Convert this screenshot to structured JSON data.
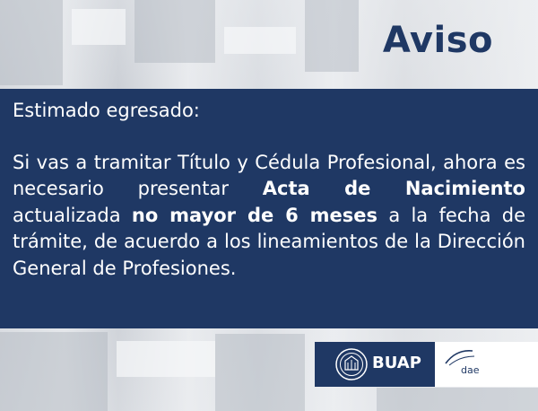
{
  "title": "Aviso",
  "notice": {
    "greeting": "Estimado egresado:",
    "p1": "Si vas a tramitar Título y Cédula Profesional, ahora es necesario presentar ",
    "b1": "Acta de Nacimiento",
    "p2": " actualizada ",
    "b2": "no mayor de 6 meses",
    "p3": " a la fecha de trámite, de acuerdo a los lineamientos de la Dirección General de  Profesiones."
  },
  "logos": {
    "buap": "BUAP",
    "dae": "dae"
  },
  "colors": {
    "navy": "#1f3864",
    "white": "#ffffff"
  },
  "icons": [
    "buap-seal-icon",
    "dae-logo-icon"
  ]
}
